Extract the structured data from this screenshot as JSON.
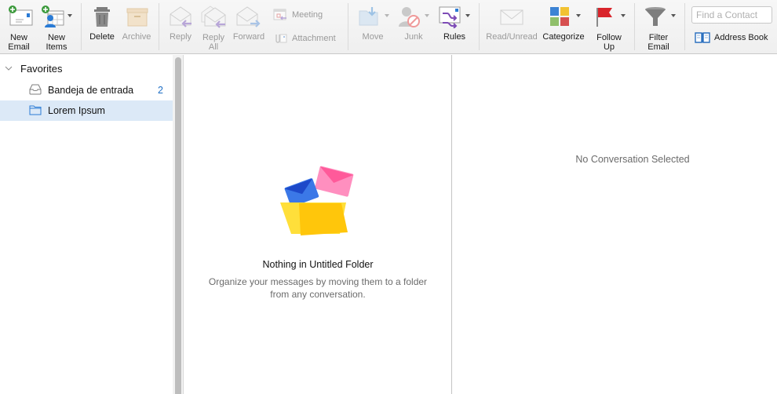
{
  "toolbar": {
    "new_email": "New\nEmail",
    "new_email_l1": "New",
    "new_email_l2": "Email",
    "new_items_l1": "New",
    "new_items_l2": "Items",
    "delete": "Delete",
    "archive": "Archive",
    "reply": "Reply",
    "reply_all_l1": "Reply",
    "reply_all_l2": "All",
    "forward": "Forward",
    "meeting": "Meeting",
    "attachment": "Attachment",
    "move": "Move",
    "junk": "Junk",
    "rules": "Rules",
    "read_unread": "Read/Unread",
    "categorize": "Categorize",
    "follow_up_l1": "Follow",
    "follow_up_l2": "Up",
    "filter_email_l1": "Filter",
    "filter_email_l2": "Email",
    "find_contact_placeholder": "Find a Contact",
    "address_book": "Address Book"
  },
  "sidebar": {
    "section": "Favorites",
    "folders": [
      {
        "name": "Bandeja de entrada",
        "count": "2",
        "icon": "inbox-icon",
        "selected": false
      },
      {
        "name": "Lorem Ipsum",
        "count": "",
        "icon": "folder-icon",
        "selected": true
      }
    ]
  },
  "message_list": {
    "empty_title": "Nothing in Untitled Folder",
    "empty_description": "Organize your messages by moving them to a folder from any conversation."
  },
  "reading_pane": {
    "placeholder": "No Conversation Selected"
  },
  "colors": {
    "accent": "#1f6fc5",
    "selection": "#dce9f7",
    "flag": "#d9242b"
  }
}
